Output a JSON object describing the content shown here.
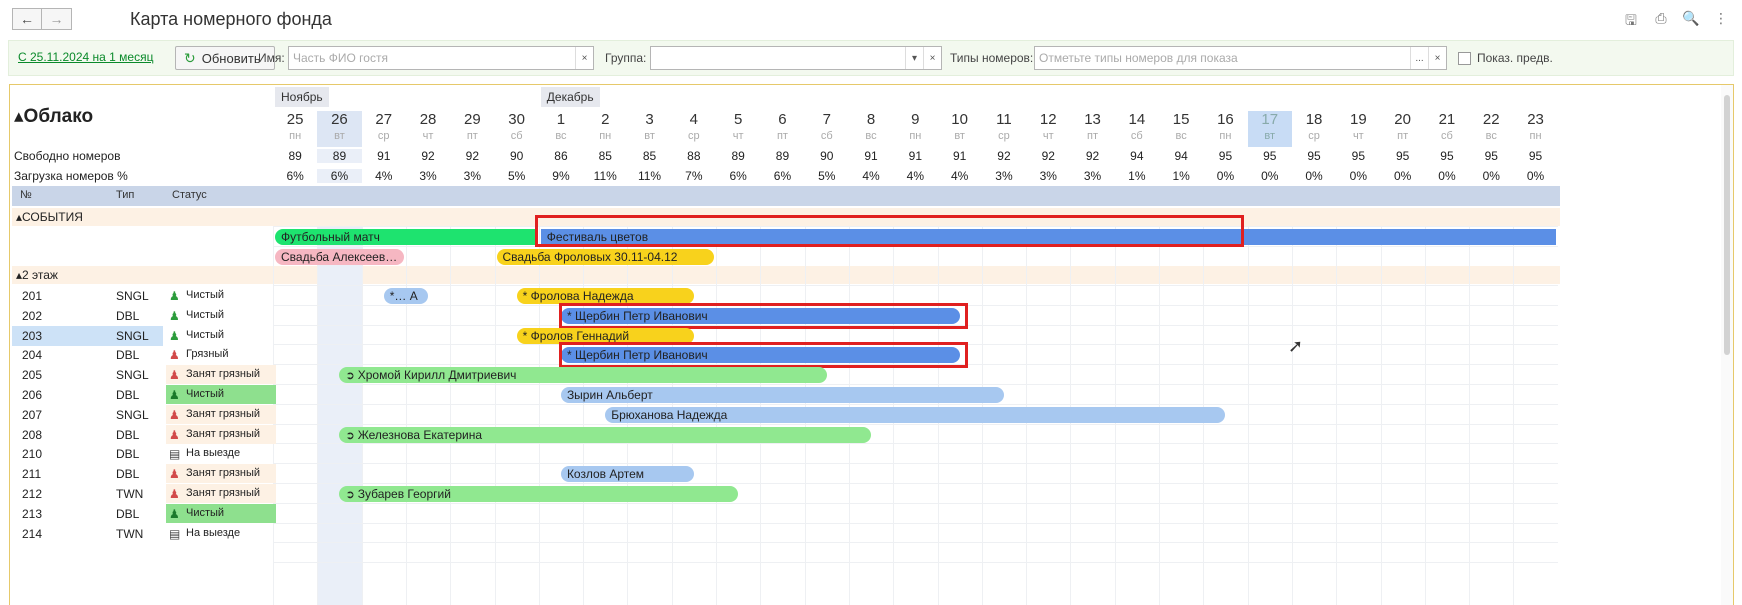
{
  "window": {
    "title": "Карта номерного фонда",
    "back_icon": "arrow-left",
    "forward_icon": "arrow-right"
  },
  "toolbar": {
    "period_link": "С 25.11.2024 на 1 месяц",
    "refresh_label": "Обновить",
    "name_label": "Имя:",
    "name_placeholder": "Часть ФИО гостя",
    "group_label": "Группа:",
    "group_value": "",
    "room_types_label": "Типы номеров:",
    "room_types_placeholder": "Отметьте типы номеров для показа",
    "show_label": "Показ. предв.",
    "clear_glyph": "×",
    "dropdown_glyph": "▾",
    "more_glyph": "..."
  },
  "board": {
    "group_title": "▴Облако",
    "free_label": "Свободно номеров",
    "load_label": "Загрузка номеров %",
    "months": [
      {
        "label": "Ноябрь",
        "start_index": 0
      },
      {
        "label": "Декабрь",
        "start_index": 6
      }
    ],
    "days": [
      {
        "num": "25",
        "dow": "пн",
        "free": "89",
        "load": "6%"
      },
      {
        "num": "26",
        "dow": "вт",
        "free": "89",
        "load": "6%"
      },
      {
        "num": "27",
        "dow": "ср",
        "free": "91",
        "load": "4%"
      },
      {
        "num": "28",
        "dow": "чт",
        "free": "92",
        "load": "3%"
      },
      {
        "num": "29",
        "dow": "пт",
        "free": "92",
        "load": "3%"
      },
      {
        "num": "30",
        "dow": "сб",
        "free": "90",
        "load": "5%"
      },
      {
        "num": "1",
        "dow": "вс",
        "free": "86",
        "load": "9%"
      },
      {
        "num": "2",
        "dow": "пн",
        "free": "85",
        "load": "11%"
      },
      {
        "num": "3",
        "dow": "вт",
        "free": "85",
        "load": "11%"
      },
      {
        "num": "4",
        "dow": "ср",
        "free": "88",
        "load": "7%"
      },
      {
        "num": "5",
        "dow": "чт",
        "free": "89",
        "load": "6%"
      },
      {
        "num": "6",
        "dow": "пт",
        "free": "89",
        "load": "6%"
      },
      {
        "num": "7",
        "dow": "сб",
        "free": "90",
        "load": "5%"
      },
      {
        "num": "8",
        "dow": "вс",
        "free": "91",
        "load": "4%"
      },
      {
        "num": "9",
        "dow": "пн",
        "free": "91",
        "load": "4%"
      },
      {
        "num": "10",
        "dow": "вт",
        "free": "91",
        "load": "4%"
      },
      {
        "num": "11",
        "dow": "ср",
        "free": "92",
        "load": "3%"
      },
      {
        "num": "12",
        "dow": "чт",
        "free": "92",
        "load": "3%"
      },
      {
        "num": "13",
        "dow": "пт",
        "free": "92",
        "load": "3%"
      },
      {
        "num": "14",
        "dow": "сб",
        "free": "94",
        "load": "1%"
      },
      {
        "num": "15",
        "dow": "вс",
        "free": "94",
        "load": "1%"
      },
      {
        "num": "16",
        "dow": "пн",
        "free": "95",
        "load": "0%"
      },
      {
        "num": "17",
        "dow": "вт",
        "free": "95",
        "load": "0%"
      },
      {
        "num": "18",
        "dow": "ср",
        "free": "95",
        "load": "0%"
      },
      {
        "num": "19",
        "dow": "чт",
        "free": "95",
        "load": "0%"
      },
      {
        "num": "20",
        "dow": "пт",
        "free": "95",
        "load": "0%"
      },
      {
        "num": "21",
        "dow": "сб",
        "free": "95",
        "load": "0%"
      },
      {
        "num": "22",
        "dow": "вс",
        "free": "95",
        "load": "0%"
      },
      {
        "num": "23",
        "dow": "пн",
        "free": "95",
        "load": "0%"
      }
    ],
    "selected_day_index": 1,
    "today_index": 22,
    "columns": {
      "no": "№",
      "type": "Тип",
      "status": "Статус"
    },
    "events_section": "▴СОБЫТИЯ",
    "floor_section": "▴2 этаж",
    "events": [
      {
        "name": "Футбольный матч",
        "start": 0,
        "end": 6,
        "lane": 0,
        "color": "#1ee36f"
      },
      {
        "name": "Фестиваль цветов",
        "start": 6,
        "end": 29,
        "lane": 0,
        "color": "#5b8fe6",
        "highlight": true
      },
      {
        "name": "Свадьба Алексеев…",
        "start": 0,
        "end": 3,
        "lane": 1,
        "color": "#f6b7c2"
      },
      {
        "name": "Свадьба Фроловых 30.11-04.12",
        "start": 5,
        "end": 10,
        "lane": 1,
        "color": "#f8d21c"
      }
    ],
    "rooms": [
      {
        "no": "201",
        "type": "SNGL",
        "status": "Чистый",
        "status_kind": "clean"
      },
      {
        "no": "202",
        "type": "DBL",
        "status": "Чистый",
        "status_kind": "clean"
      },
      {
        "no": "203",
        "type": "SNGL",
        "status": "Чистый",
        "status_kind": "clean",
        "selected": true
      },
      {
        "no": "204",
        "type": "DBL",
        "status": "Грязный",
        "status_kind": "dirty"
      },
      {
        "no": "205",
        "type": "SNGL",
        "status": "Занят грязный",
        "status_kind": "occ-dirty"
      },
      {
        "no": "206",
        "type": "DBL",
        "status": "Чистый",
        "status_kind": "clean-green"
      },
      {
        "no": "207",
        "type": "SNGL",
        "status": "Занят грязный",
        "status_kind": "occ-dirty"
      },
      {
        "no": "208",
        "type": "DBL",
        "status": "Занят грязный",
        "status_kind": "occ-dirty"
      },
      {
        "no": "210",
        "type": "DBL",
        "status": "На выезде",
        "status_kind": "checkout"
      },
      {
        "no": "211",
        "type": "DBL",
        "status": "Занят грязный",
        "status_kind": "occ-dirty"
      },
      {
        "no": "212",
        "type": "TWN",
        "status": "Занят грязный",
        "status_kind": "occ-dirty"
      },
      {
        "no": "213",
        "type": "DBL",
        "status": "Чистый",
        "status_kind": "clean-green"
      },
      {
        "no": "214",
        "type": "TWN",
        "status": "На выезде",
        "status_kind": "checkout"
      }
    ],
    "bookings": [
      {
        "row": 0,
        "name": "*… А",
        "start": 2.5,
        "end": 3.5,
        "color": "#a7c8f0"
      },
      {
        "row": 0,
        "name": "* Фролова Надежда",
        "start": 5.5,
        "end": 9.5,
        "color": "#f8d21c"
      },
      {
        "row": 1,
        "name": "* Щербин Петр Иванович",
        "start": 6.5,
        "end": 15.5,
        "color": "#5b8fe6",
        "highlight": true
      },
      {
        "row": 2,
        "name": "* Фролов Геннадий",
        "start": 5.5,
        "end": 9.5,
        "color": "#f8d21c"
      },
      {
        "row": 3,
        "name": "* Щербин Петр Иванович",
        "start": 6.5,
        "end": 15.5,
        "color": "#5b8fe6",
        "highlight": true
      },
      {
        "row": 4,
        "name": "Хромой Кирилл Дмитриевич",
        "start": 1.5,
        "end": 12.5,
        "color": "#90e890",
        "checkin": true
      },
      {
        "row": 5,
        "name": "Зырин Альберт",
        "start": 6.5,
        "end": 16.5,
        "color": "#a7c8f0"
      },
      {
        "row": 6,
        "name": "Брюханова Надежда",
        "start": 7.5,
        "end": 21.5,
        "color": "#a7c8f0"
      },
      {
        "row": 7,
        "name": "Железнова Екатерина",
        "start": 1.5,
        "end": 13.5,
        "color": "#90e890",
        "checkin": true
      },
      {
        "row": 9,
        "name": "Козлов Артем",
        "start": 6.5,
        "end": 9.5,
        "color": "#a7c8f0"
      },
      {
        "row": 10,
        "name": "Зубарев Георгий",
        "start": 1.5,
        "end": 10.5,
        "color": "#90e890",
        "checkin": true
      }
    ]
  }
}
